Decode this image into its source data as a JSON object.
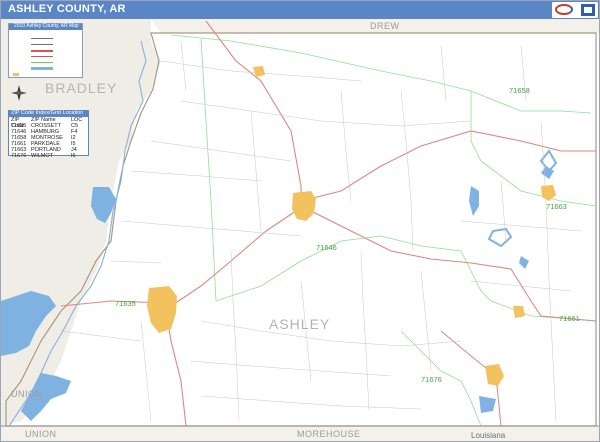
{
  "header": {
    "title": "ASHLEY COUNTY, AR",
    "bar_color": "#5b86c5"
  },
  "legend": {
    "title": "2010 Ashley County, AR Map"
  },
  "zip_table": {
    "title": "ZIP Code Index/Grid Location",
    "columns": [
      "ZIP Code",
      "ZIP Name",
      "LOC"
    ],
    "rows": [
      [
        "71635",
        "CROSSETT",
        "C5"
      ],
      [
        "71646",
        "HAMBURG",
        "F4"
      ],
      [
        "71658",
        "MONTROSE",
        "I2"
      ],
      [
        "71661",
        "PARKDALE",
        "I5"
      ],
      [
        "71663",
        "PORTLAND",
        "J4"
      ],
      [
        "71676",
        "WILMOT",
        "I6"
      ]
    ]
  },
  "map": {
    "county_label": "ASHLEY",
    "neighbors": {
      "north": "DREW",
      "west": "BRADLEY",
      "southwest": "UNION",
      "south_left": "UNION",
      "south_mid": "MOREHOUSE"
    },
    "state_label": "Louisiana",
    "zip_labels": [
      "71658",
      "71663",
      "71646",
      "71635",
      "71661",
      "71676"
    ],
    "colors": {
      "water": "#7fb2e0",
      "city": "#f2c25e",
      "highway": "#d9534f",
      "road": "#b9b9b9",
      "zip_boundary": "#5fd35f",
      "neighbor_fill": "#f0ede6"
    }
  }
}
